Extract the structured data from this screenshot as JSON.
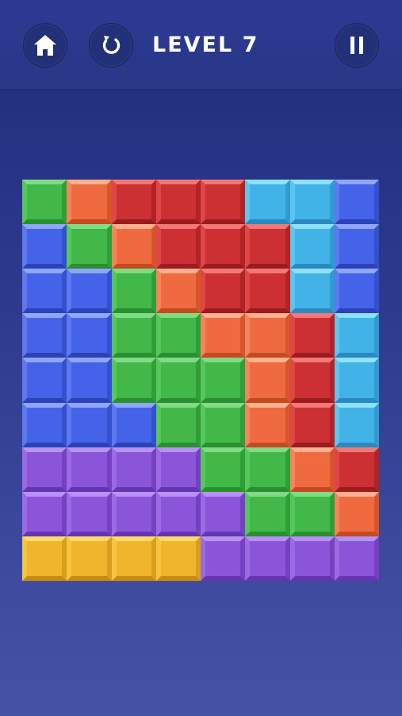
{
  "header": {
    "level_label": "LEVEL 7",
    "buttons": [
      {
        "name": "home-button",
        "icon": "home-icon"
      },
      {
        "name": "restart-button",
        "icon": "restart-icon"
      },
      {
        "name": "pause-button",
        "icon": "pause-icon"
      }
    ]
  },
  "colors": {
    "G": {
      "name": "green",
      "base": "#41b848",
      "light": "#7fdc84",
      "mid": "#55c75b",
      "dark": "#2a8f31",
      "dark2": "#309e37"
    },
    "O": {
      "name": "orange",
      "base": "#ef6a3f",
      "light": "#ffb08f",
      "mid": "#f5845c",
      "dark": "#c44a22",
      "dark2": "#d8552b"
    },
    "R": {
      "name": "red",
      "base": "#cc3033",
      "light": "#f27878",
      "mid": "#de4748",
      "dark": "#9a1c1f",
      "dark2": "#b02427"
    },
    "C": {
      "name": "cyan",
      "base": "#41b3e6",
      "light": "#8ee1fb",
      "mid": "#5cc6f1",
      "dark": "#2a89bf",
      "dark2": "#319bd1"
    },
    "B": {
      "name": "blue",
      "base": "#4463e8",
      "light": "#8fa6fb",
      "mid": "#5e79ef",
      "dark": "#2b43b8",
      "dark2": "#3350cf"
    },
    "P": {
      "name": "purple",
      "base": "#8a55d8",
      "light": "#b892f0",
      "mid": "#9c6ae2",
      "dark": "#6435ae",
      "dark2": "#7541c2"
    },
    "Y": {
      "name": "yellow",
      "base": "#f0b52c",
      "light": "#ffd86c",
      "mid": "#f6c443",
      "dark": "#c78a12",
      "dark2": "#db9d1c"
    }
  },
  "grid": [
    [
      "G",
      "O",
      "R",
      "R",
      "R",
      "C",
      "C",
      "B"
    ],
    [
      "B",
      "G",
      "O",
      "R",
      "R",
      "R",
      "C",
      "B"
    ],
    [
      "B",
      "B",
      "G",
      "O",
      "R",
      "R",
      "C",
      "B"
    ],
    [
      "B",
      "B",
      "G",
      "G",
      "O",
      "O",
      "R",
      "C"
    ],
    [
      "B",
      "B",
      "G",
      "G",
      "G",
      "O",
      "R",
      "C"
    ],
    [
      "B",
      "B",
      "B",
      "G",
      "G",
      "O",
      "R",
      "C"
    ],
    [
      "P",
      "P",
      "P",
      "P",
      "G",
      "G",
      "O",
      "R"
    ],
    [
      "P",
      "P",
      "P",
      "P",
      "P",
      "G",
      "G",
      "O"
    ],
    [
      "Y",
      "Y",
      "Y",
      "Y",
      "P",
      "P",
      "P",
      "P"
    ]
  ]
}
